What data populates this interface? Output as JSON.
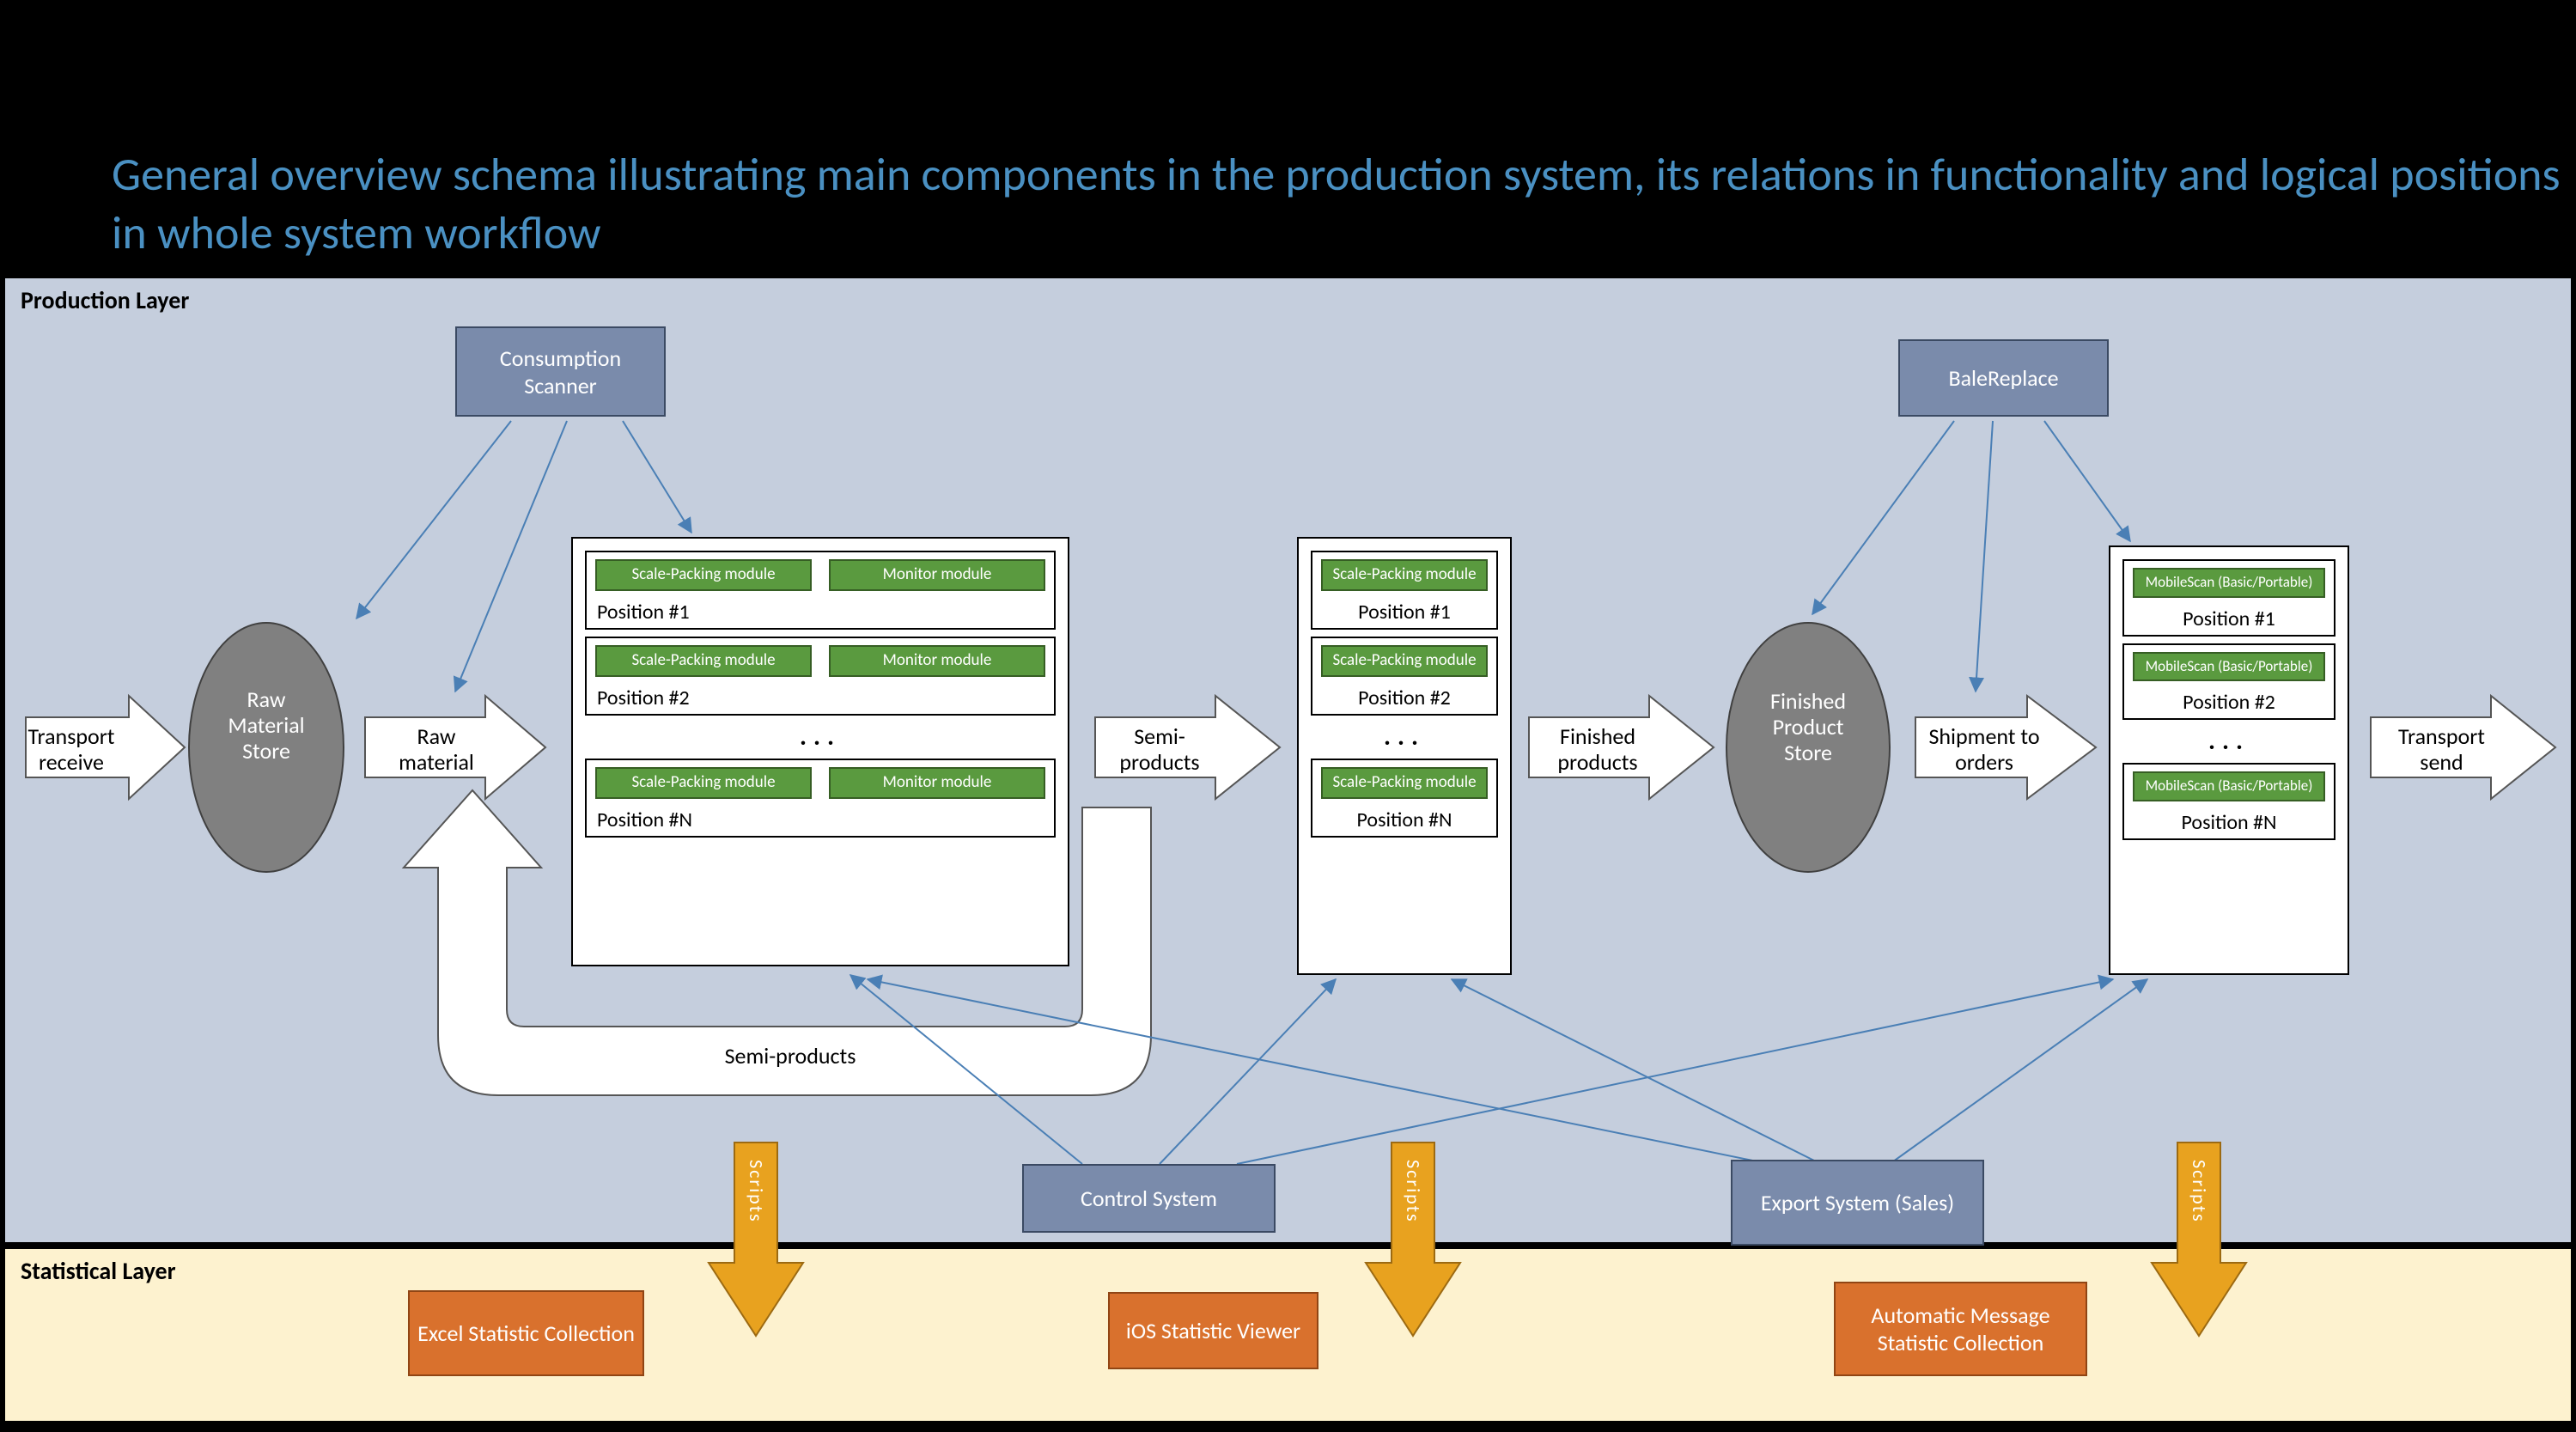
{
  "title": "General overview schema illustrating main components in the production system, its relations in functionality and logical positions in whole system workflow",
  "layers": {
    "production": "Production Layer",
    "statistical": "Statistical Layer"
  },
  "flow_labels": {
    "transport_receive": "Transport receive",
    "raw_material": "Raw material",
    "semi_products": "Semi-products",
    "finished_products": "Finished products",
    "shipment_to_orders": "Shipment to orders",
    "transport_send": "Transport send"
  },
  "ovals": {
    "raw_store": "Raw Material Store",
    "finished_store": "Finished Product Store"
  },
  "blue_nodes": {
    "consumption_scanner": "Consumption Scanner",
    "bale_replace": "BaleReplace",
    "control_system": "Control System",
    "export_system": "Export System (Sales)"
  },
  "orange_nodes": {
    "excel": "Excel Statistic Collection",
    "ios": "iOS Statistic Viewer",
    "amsc": "Automatic Message Statistic Collection"
  },
  "scripts_arrow_label": "Scripts",
  "group_a": {
    "positions": [
      {
        "label": "Position #1",
        "modules": [
          "Scale-Packing module",
          "Monitor module"
        ]
      },
      {
        "label": "Position #2",
        "modules": [
          "Scale-Packing module",
          "Monitor module"
        ]
      },
      {
        "label": "Position #N",
        "modules": [
          "Scale-Packing module",
          "Monitor module"
        ]
      }
    ],
    "ellipsis": "..."
  },
  "group_b": {
    "positions": [
      {
        "label": "Position #1",
        "modules": [
          "Scale-Packing module"
        ]
      },
      {
        "label": "Position #2",
        "modules": [
          "Scale-Packing module"
        ]
      },
      {
        "label": "Position #N",
        "modules": [
          "Scale-Packing module"
        ]
      }
    ],
    "ellipsis": "..."
  },
  "group_c": {
    "positions": [
      {
        "label": "Position #1",
        "modules": [
          "MobileScan (Basic/Portable)"
        ]
      },
      {
        "label": "Position #2",
        "modules": [
          "MobileScan (Basic/Portable)"
        ]
      },
      {
        "label": "Position #N",
        "modules": [
          "MobileScan (Basic/Portable)"
        ]
      }
    ],
    "ellipsis": "..."
  },
  "recycle_label": "Semi-products"
}
